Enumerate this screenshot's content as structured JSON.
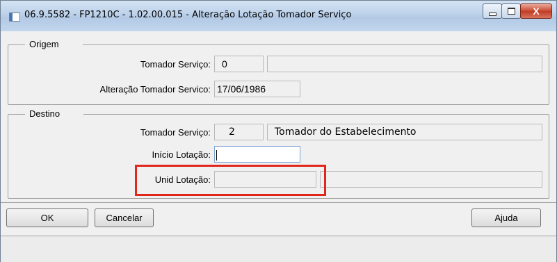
{
  "window": {
    "title": "06.9.5582 - FP1210C - 1.02.00.015 - Alteração Lotação Tomador Serviço",
    "close_glyph": "X",
    "icons": [
      "app-icon",
      "minimize-icon",
      "maximize-icon",
      "close-icon"
    ]
  },
  "origem": {
    "legend": "Origem",
    "tomador_label": "Tomador Serviço:",
    "tomador_code": "0",
    "tomador_name": "",
    "alteracao_label": "Alteração Tomador Servico:",
    "alteracao_date": "17/06/1986"
  },
  "destino": {
    "legend": "Destino",
    "tomador_label": "Tomador Serviço:",
    "tomador_code": "2",
    "tomador_name": "Tomador do Estabelecimento",
    "inicio_label": "Início Lotação:",
    "inicio_value": "",
    "unid_label": "Unid Lotação:",
    "unid_code": "",
    "unid_name": ""
  },
  "buttons": {
    "ok": "OK",
    "cancel": "Cancelar",
    "help": "Ajuda"
  },
  "colors": {
    "highlight": "#e1261c",
    "close_button": "#c9472f"
  }
}
